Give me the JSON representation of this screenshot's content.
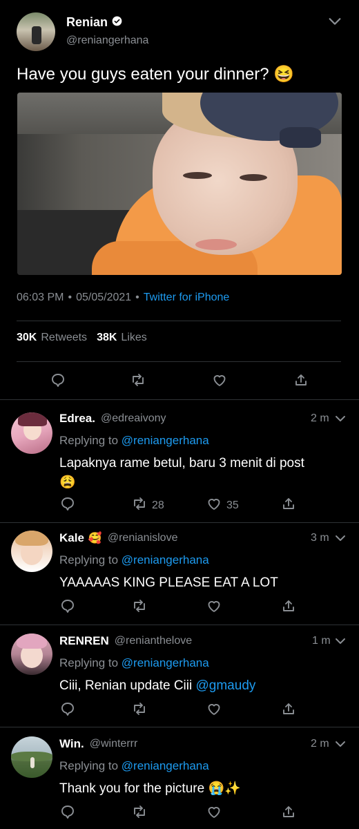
{
  "tweet": {
    "author_name": "Renian",
    "author_handle": "@reniangerhana",
    "text": "Have you guys eaten your dinner?",
    "text_emoji": "😆",
    "time": "06:03 PM",
    "dot1": "•",
    "date": "05/05/2021",
    "dot2": "•",
    "source": "Twitter for iPhone",
    "retweets_count": "30K",
    "retweets_label": "Retweets",
    "likes_count": "38K",
    "likes_label": "Likes"
  },
  "replies": [
    {
      "name": "Edrea.",
      "name_emoji": "",
      "handle": "@edreaivony",
      "time": "2 m",
      "replying_label": "Replying to",
      "replying_handle": "@reniangerhana",
      "text": "Lapaknya rame betul, baru 3 menit di post",
      "text_emoji": "😩",
      "retweets": "28",
      "likes": "35"
    },
    {
      "name": "Kale",
      "name_emoji": "🥰",
      "handle": "@renianislove",
      "time": "3 m",
      "replying_label": "Replying to",
      "replying_handle": "@reniangerhana",
      "text": "YAAAAAS KING PLEASE EAT A LOT"
    },
    {
      "name": "RENREN",
      "handle": "@renianthelove",
      "time": "1 m",
      "replying_label": "Replying to",
      "replying_handle": "@reniangerhana",
      "text": "Ciii, Renian update Ciii",
      "mention": "@gmaudy"
    },
    {
      "name": "Win.",
      "handle": "@winterrr",
      "time": "2 m",
      "replying_label": "Replying to",
      "replying_handle": "@reniangerhana",
      "text": "Thank you for the picture",
      "text_emoji": "😭✨"
    }
  ],
  "colors": {
    "background": "#000000",
    "link": "#1d9bf0",
    "muted": "#8b8f94",
    "separator": "#2f3336"
  },
  "icons": [
    "verified-badge-icon",
    "chevron-down-icon",
    "reply-icon",
    "retweet-icon",
    "like-icon",
    "share-icon"
  ]
}
